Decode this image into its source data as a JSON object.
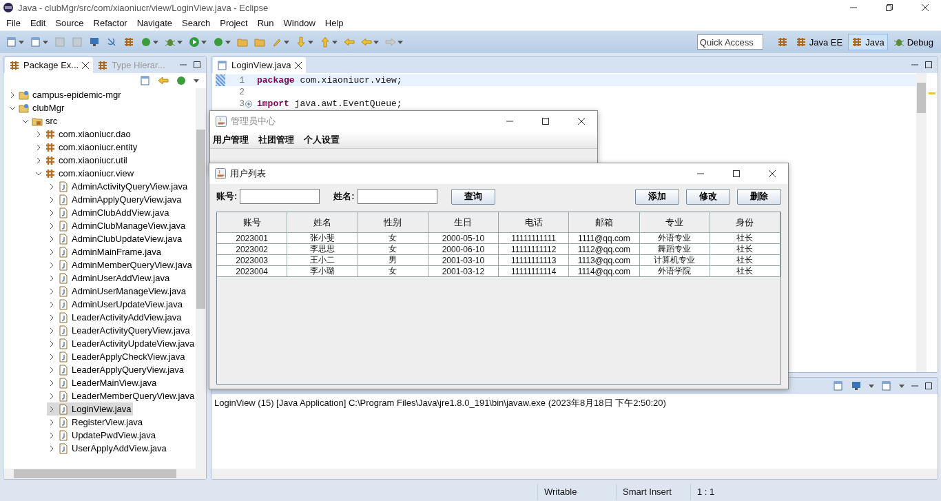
{
  "window": {
    "title": "Java - clubMgr/src/com/xiaoniucr/view/LoginView.java - Eclipse"
  },
  "menu": [
    "File",
    "Edit",
    "Source",
    "Refactor",
    "Navigate",
    "Search",
    "Project",
    "Run",
    "Window",
    "Help"
  ],
  "quick_access": {
    "placeholder": "Quick Access"
  },
  "perspectives": [
    {
      "label": "Java EE",
      "selected": false
    },
    {
      "label": "Java",
      "selected": true
    },
    {
      "label": "Debug",
      "selected": false
    }
  ],
  "explorer": {
    "tabs": [
      {
        "label": "Package Ex...",
        "selected": true
      },
      {
        "label": "Type Hierar...",
        "selected": false
      }
    ],
    "tree": [
      {
        "label": "campus-epidemic-mgr",
        "kind": "project",
        "expanded": false,
        "selected": false
      },
      {
        "label": "clubMgr",
        "kind": "project",
        "expanded": true,
        "selected": false,
        "children": [
          {
            "label": "src",
            "kind": "folder",
            "expanded": true,
            "selected": false,
            "children": [
              {
                "label": "com.xiaoniucr.dao",
                "kind": "package",
                "expanded": false,
                "selected": false
              },
              {
                "label": "com.xiaoniucr.entity",
                "kind": "package",
                "expanded": false,
                "selected": false
              },
              {
                "label": "com.xiaoniucr.util",
                "kind": "package",
                "expanded": false,
                "selected": false
              },
              {
                "label": "com.xiaoniucr.view",
                "kind": "package",
                "expanded": true,
                "selected": false,
                "children": [
                  {
                    "label": "AdminActivityQueryView.java",
                    "kind": "file",
                    "expanded": false,
                    "selected": false
                  },
                  {
                    "label": "AdminApplyQueryView.java",
                    "kind": "file",
                    "expanded": false,
                    "selected": false
                  },
                  {
                    "label": "AdminClubAddView.java",
                    "kind": "file",
                    "expanded": false,
                    "selected": false
                  },
                  {
                    "label": "AdminClubManageView.java",
                    "kind": "file",
                    "expanded": false,
                    "selected": false
                  },
                  {
                    "label": "AdminClubUpdateView.java",
                    "kind": "file",
                    "expanded": false,
                    "selected": false
                  },
                  {
                    "label": "AdminMainFrame.java",
                    "kind": "file",
                    "expanded": false,
                    "selected": false
                  },
                  {
                    "label": "AdminMemberQueryView.java",
                    "kind": "file",
                    "expanded": false,
                    "selected": false
                  },
                  {
                    "label": "AdminUserAddView.java",
                    "kind": "file",
                    "expanded": false,
                    "selected": false
                  },
                  {
                    "label": "AdminUserManageView.java",
                    "kind": "file",
                    "expanded": false,
                    "selected": false
                  },
                  {
                    "label": "AdminUserUpdateView.java",
                    "kind": "file",
                    "expanded": false,
                    "selected": false
                  },
                  {
                    "label": "LeaderActivityAddView.java",
                    "kind": "file",
                    "expanded": false,
                    "selected": false
                  },
                  {
                    "label": "LeaderActivityQueryView.java",
                    "kind": "file",
                    "expanded": false,
                    "selected": false
                  },
                  {
                    "label": "LeaderActivityUpdateView.java",
                    "kind": "file",
                    "expanded": false,
                    "selected": false
                  },
                  {
                    "label": "LeaderApplyCheckView.java",
                    "kind": "file",
                    "expanded": false,
                    "selected": false
                  },
                  {
                    "label": "LeaderApplyQueryView.java",
                    "kind": "file",
                    "expanded": false,
                    "selected": false
                  },
                  {
                    "label": "LeaderMainView.java",
                    "kind": "file",
                    "expanded": false,
                    "selected": false
                  },
                  {
                    "label": "LeaderMemberQueryView.java",
                    "kind": "file",
                    "expanded": false,
                    "selected": false
                  },
                  {
                    "label": "LoginView.java",
                    "kind": "file",
                    "expanded": false,
                    "selected": true
                  },
                  {
                    "label": "RegisterView.java",
                    "kind": "file",
                    "expanded": false,
                    "selected": false
                  },
                  {
                    "label": "UpdatePwdView.java",
                    "kind": "file",
                    "expanded": false,
                    "selected": false
                  },
                  {
                    "label": "UserApplyAddView.java",
                    "kind": "file",
                    "expanded": false,
                    "selected": false
                  }
                ]
              }
            ]
          }
        ]
      }
    ]
  },
  "editor": {
    "tabs": [
      {
        "label": "LoginView.java",
        "selected": true
      }
    ],
    "lines": [
      {
        "number": "1",
        "code": "**package** com.xiaoniucr.view;",
        "current": true,
        "folded": false
      },
      {
        "number": "2",
        "current": false,
        "folded": false
      },
      {
        "number": "3",
        "code": "**import** java.awt.EventQueue;",
        "current": false,
        "folded": true
      }
    ]
  },
  "console": {
    "text": "LoginView (15) [Java Application] C:\\Program Files\\Java\\jre1.8.0_191\\bin\\javaw.exe (2023年8月18日 下午2:50:20)"
  },
  "status_bar": [
    "Writable",
    "Smart Insert",
    "1 : 1"
  ],
  "admin_window": {
    "title": "管理员中心",
    "menu": [
      "用户管理",
      "社团管理",
      "个人设置"
    ]
  },
  "user_window": {
    "title": "用户列表",
    "fields": [
      {
        "label": "账号:"
      },
      {
        "label": "姓名:"
      }
    ],
    "query_button": "查询",
    "actions": [
      "添加",
      "修改",
      "删除"
    ],
    "table": {
      "columns": [
        "账号",
        "姓名",
        "性别",
        "生日",
        "电话",
        "邮箱",
        "专业",
        "身份"
      ],
      "rows": [
        [
          "2023001",
          "张小斐",
          "女",
          "2000-05-10",
          "11111111111",
          "1111@qq.com",
          "外语专业",
          "社长"
        ],
        [
          "2023002",
          "李思思",
          "女",
          "2000-06-10",
          "11111111112",
          "1112@qq.com",
          "舞蹈专业",
          "社长"
        ],
        [
          "2023003",
          "王小二",
          "男",
          "2001-03-10",
          "11111111113",
          "1113@qq.com",
          "计算机专业",
          "社长"
        ],
        [
          "2023004",
          "李小璐",
          "女",
          "2001-03-12",
          "11111111114",
          "1114@qq.com",
          "外语学院",
          "社长"
        ]
      ]
    }
  }
}
